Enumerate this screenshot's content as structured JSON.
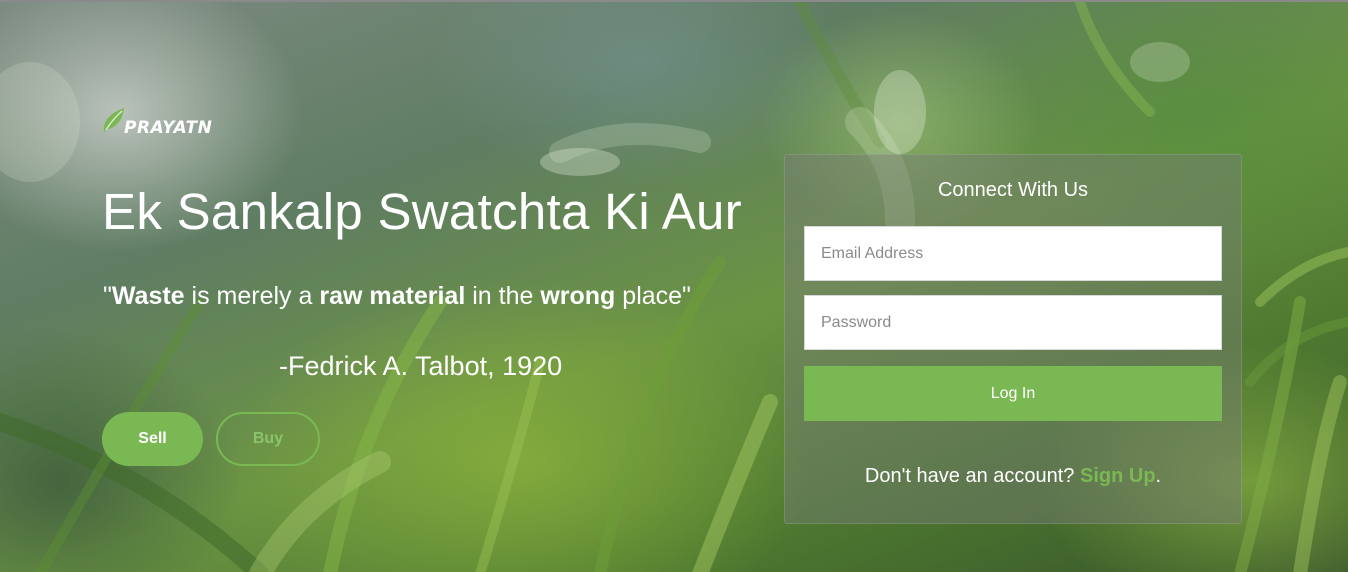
{
  "brand": {
    "logo_text": "PRAYATN"
  },
  "hero": {
    "headline": "Ek Sankalp Swatchta Ki Aur",
    "quote": {
      "open": "\"",
      "w1": "Waste",
      "t1": " is merely a ",
      "w2": "raw material",
      "t2": " in the ",
      "w3": "wrong",
      "t3": " place\""
    },
    "author": "-Fedrick A. Talbot, 1920",
    "sell_label": "Sell",
    "buy_label": "Buy"
  },
  "login": {
    "title": "Connect With Us",
    "email_placeholder": "Email Address",
    "email_value": "",
    "password_placeholder": "Password",
    "password_value": "",
    "login_label": "Log In",
    "signup_prompt": "Don't have an account? ",
    "signup_link": "Sign Up",
    "signup_suffix": "."
  },
  "colors": {
    "accent": "#7ab854",
    "panel_bg": "rgba(120,125,120,0.45)"
  },
  "icons": {
    "logo_leaf": "leaf-icon"
  }
}
